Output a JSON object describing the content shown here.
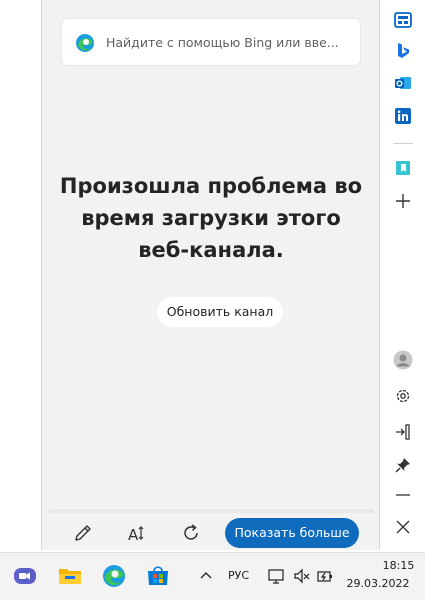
{
  "search": {
    "placeholder": "Найдите с помощью Bing или вве..."
  },
  "feed": {
    "error_message": "Произошла проблема во время загрузки этого веб-канала.",
    "reload_button": "Обновить канал"
  },
  "bottom_bar": {
    "show_more_button": "Показать больше",
    "icons": [
      "pencil-icon",
      "text-size-icon",
      "refresh-icon"
    ]
  },
  "sidebar": {
    "items": [
      "news-icon",
      "bing-icon",
      "outlook-icon",
      "linkedin-icon",
      "bookmark-app-icon",
      "add-icon",
      "avatar",
      "settings-icon",
      "dock-icon",
      "pin-icon",
      "minimize-icon",
      "close-icon"
    ]
  },
  "taskbar": {
    "apps": [
      "teams-chat-icon",
      "file-explorer-icon",
      "edge-icon",
      "store-icon"
    ],
    "language": "РУС",
    "time": "18:15",
    "date": "29.03.2022"
  },
  "colors": {
    "accent": "#0f6cbd",
    "panel_background": "#f2f2f2",
    "sidebar_icon_blue": "#0a66c2"
  }
}
